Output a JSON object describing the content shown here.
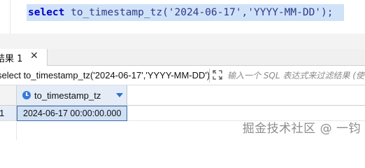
{
  "editor": {
    "sql_keyword": "select",
    "sql_rest": " to_timestamp_tz('2024-06-17','YYYY-MM-DD');"
  },
  "results": {
    "tab_label": "结果 1",
    "tab_close": "✕",
    "query_text": "select to_timestamp_tz('2024-06-17','YYYY-MM-DD')",
    "filter_placeholder": "输入一个 SQL 表达式来过滤结果 (使",
    "columns": [
      {
        "name": "to_timestamp_tz",
        "icon": "clock-icon"
      }
    ],
    "rows": [
      {
        "num": "1",
        "values": [
          "2024-06-17 00:00:00.000"
        ]
      }
    ]
  },
  "watermark": "掘金技术社区 @ 一钧",
  "colors": {
    "selection": "#cfe2f8",
    "keyword": "#0000c8",
    "header_bg": "#e4ecf7",
    "accent": "#2b6fd0"
  }
}
